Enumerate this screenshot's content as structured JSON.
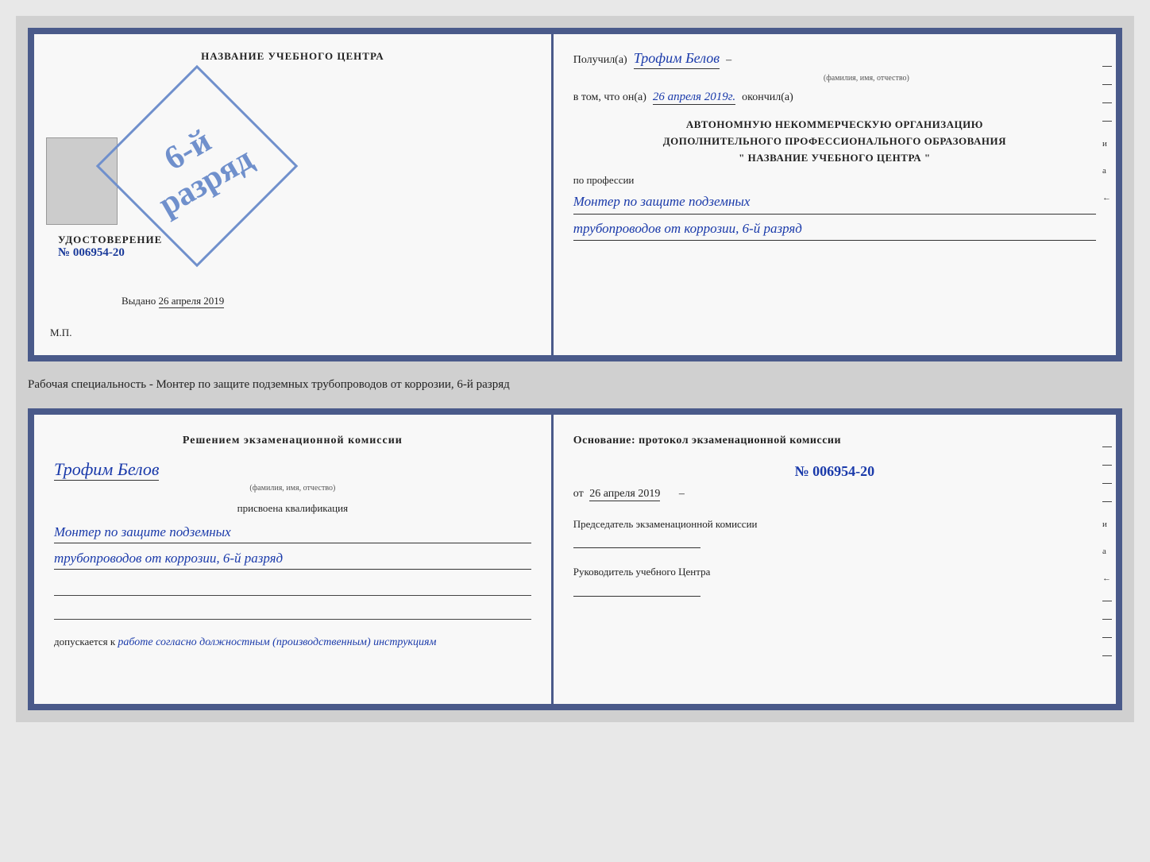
{
  "diploma": {
    "left": {
      "center_name": "НАЗВАНИЕ УЧЕБНОГО ЦЕНТРА",
      "stamp_line1": "6-й",
      "stamp_line2": "разряд",
      "photo_alt": "фото",
      "udostoverenie_title": "УДОСТОВЕРЕНИЕ",
      "udostoverenie_num": "№ 006954-20",
      "vydano_label": "Выдано",
      "vydano_date": "26 апреля 2019",
      "mp_label": "М.П."
    },
    "right": {
      "poluchil_prefix": "Получил(а)",
      "handwritten_name": "Трофим Белов",
      "name_dash": "–",
      "name_small_label": "(фамилия, имя, отчество)",
      "vtom_prefix": "в том, что он(а)",
      "handwritten_date": "26 апреля 2019г.",
      "okonchil": "окончил(а)",
      "org_line1": "АВТОНОМНУЮ НЕКОММЕРЧЕСКУЮ ОРГАНИЗАЦИЮ",
      "org_line2": "ДОПОЛНИТЕЛЬНОГО ПРОФЕССИОНАЛЬНОГО ОБРАЗОВАНИЯ",
      "org_line3": "\"    НАЗВАНИЕ УЧЕБНОГО ЦЕНТРА    \"",
      "po_professii": "по профессии",
      "profession_line1": "Монтер по защите подземных",
      "profession_line2": "трубопроводов от коррозии, 6-й разряд",
      "side_letters": [
        "и",
        "а",
        "←"
      ]
    }
  },
  "divider": {
    "text": "Рабочая специальность - Монтер по защите подземных трубопроводов от коррозии, 6-й разряд"
  },
  "bottom": {
    "left": {
      "resheniem_title": "Решением экзаменационной комиссии",
      "handwritten_name": "Трофим Белов",
      "name_small_label": "(фамилия, имя, отчество)",
      "prisvoena": "присвоена квалификация",
      "profession_line1": "Монтер по защите подземных",
      "profession_line2": "трубопроводов от коррозии, 6-й разряд",
      "dopuskaetsya_prefix": "допускается к",
      "dopuskaetsya_handwritten": "работе согласно должностным (производственным) инструкциям"
    },
    "right": {
      "osnovanie_title": "Основание: протокол экзаменационной комиссии",
      "protocol_num": "№ 006954-20",
      "ot_label": "от",
      "protocol_date": "26 апреля 2019",
      "predsedatel_title": "Председатель экзаменационной комиссии",
      "rukovoditel_title": "Руководитель учебного Центра",
      "side_letters": [
        "и",
        "а",
        "←"
      ]
    }
  }
}
